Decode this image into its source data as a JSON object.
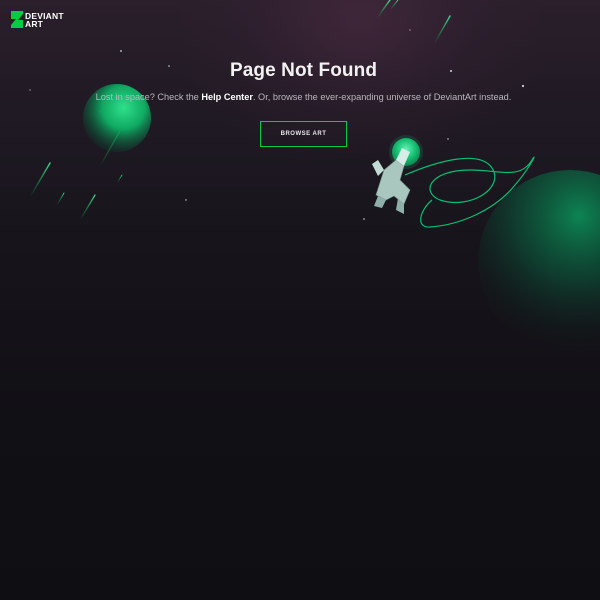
{
  "brand": {
    "name_line1": "DEVIANT",
    "name_line2": "ART",
    "accent_color": "#05cc47"
  },
  "error": {
    "title": "Page Not Found",
    "message_before": "Lost in space? Check the",
    "help_link": "Help Center",
    "message_after": ". Or, browse the ever-expanding universe of DeviantArt instead."
  },
  "actions": {
    "browse_label": "BROWSE ART"
  },
  "illustration": {
    "icons": [
      "deviantart-logo-icon",
      "planet-icon",
      "astronaut-icon",
      "large-planet-icon",
      "shooting-star-icon"
    ]
  }
}
